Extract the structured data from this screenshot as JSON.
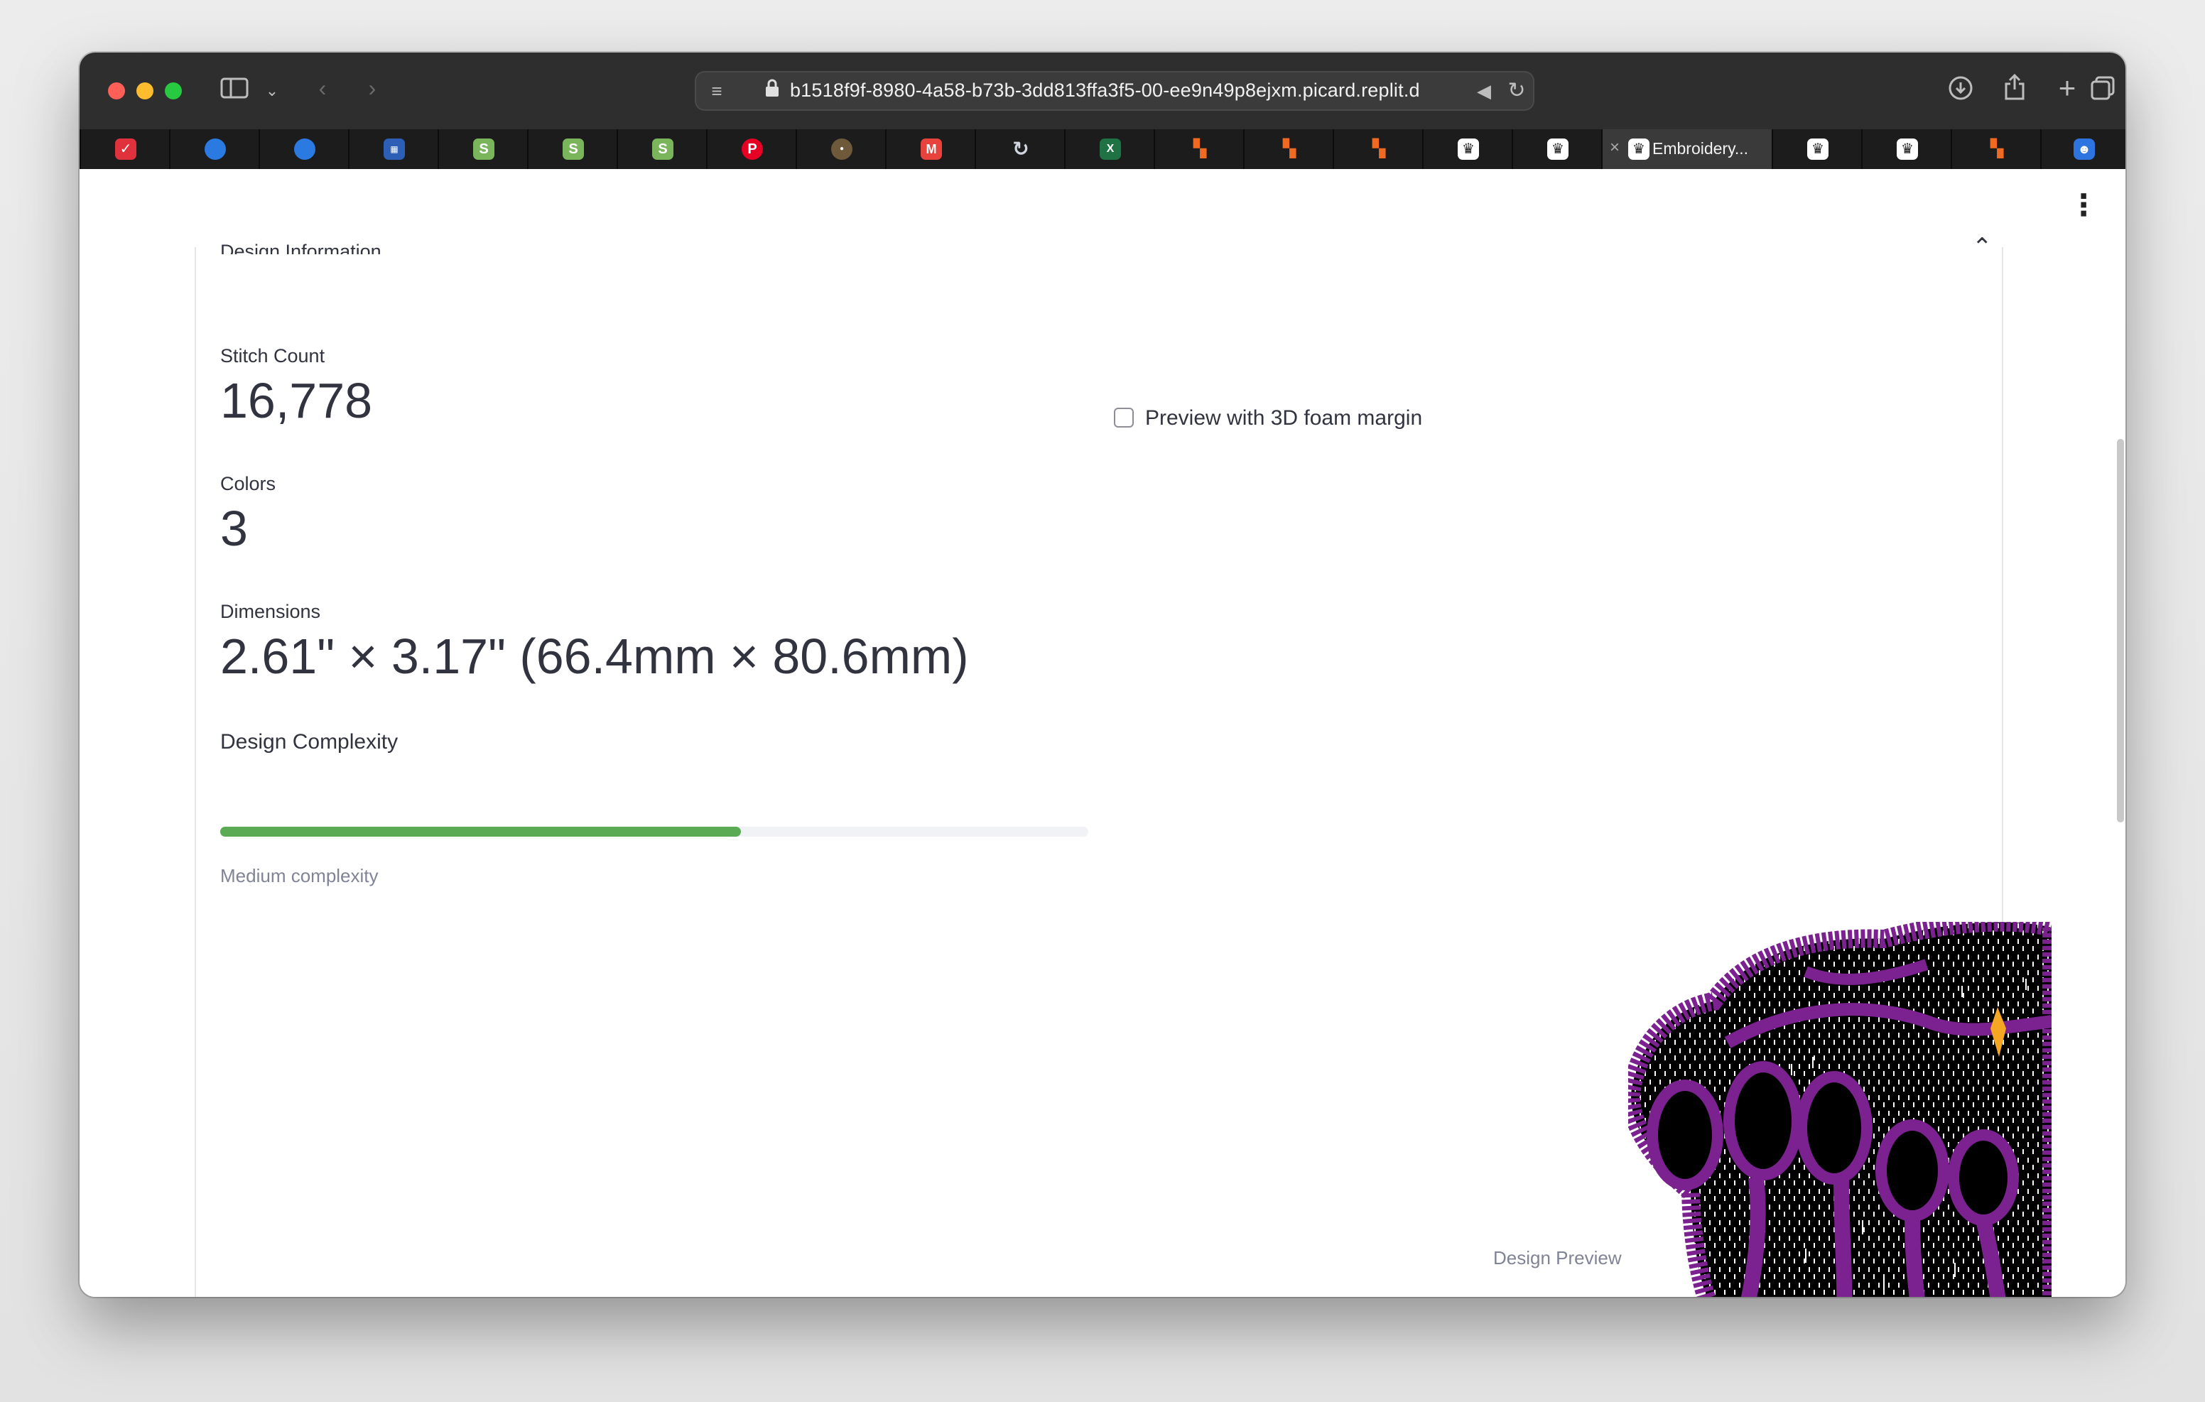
{
  "browser": {
    "url": "b1518f9f-8980-4a58-b73b-3dd813ffa3f5-00-ee9n49p8ejxm.picard.replit.d",
    "active_tab_title": "Embroidery...",
    "tabs": [
      {
        "icon": "checklist-app-icon",
        "color": "#e0323c"
      },
      {
        "icon": "blue-circle-icon",
        "color": "#2a7ae2"
      },
      {
        "icon": "blue-circle-icon",
        "color": "#2a7ae2"
      },
      {
        "icon": "card-app-icon",
        "color": "#2d5fb6"
      },
      {
        "icon": "shopify-icon",
        "color": "#7ab55c"
      },
      {
        "icon": "shopify-icon",
        "color": "#7ab55c"
      },
      {
        "icon": "shopify-icon",
        "color": "#7ab55c"
      },
      {
        "icon": "pinterest-icon",
        "color": "#e60023"
      },
      {
        "icon": "round-logo-icon",
        "color": "#6e5a3a"
      },
      {
        "icon": "mail-icon",
        "color": "#e8423c"
      },
      {
        "icon": "sync-icon",
        "color": "#9aa4b2"
      },
      {
        "icon": "excel-icon",
        "color": "#1f7244"
      },
      {
        "icon": "orange-blocks-icon",
        "color": "#f06a22"
      },
      {
        "icon": "orange-blocks-icon",
        "color": "#f06a22"
      },
      {
        "icon": "orange-blocks-icon",
        "color": "#f06a22"
      },
      {
        "icon": "crown-icon",
        "color": "#ffffff"
      },
      {
        "icon": "crown-icon",
        "color": "#ffffff"
      },
      {
        "icon": "crown-icon",
        "color": "#ffffff",
        "active": true
      },
      {
        "icon": "crown-icon",
        "color": "#ffffff"
      },
      {
        "icon": "crown-icon",
        "color": "#ffffff"
      },
      {
        "icon": "orange-blocks-icon",
        "color": "#f06a22"
      },
      {
        "icon": "chat-app-icon",
        "color": "#2d74e0"
      }
    ]
  },
  "page": {
    "section_title": "Design Information",
    "stitch_count": {
      "label": "Stitch Count",
      "value": "16,778"
    },
    "colors": {
      "label": "Colors",
      "value": "3"
    },
    "dimensions": {
      "label": "Dimensions",
      "value": "2.61\" × 3.17\" (66.4mm × 80.6mm)"
    },
    "complexity": {
      "label": "Design Complexity",
      "caption": "Medium complexity",
      "progress_fraction": 0.6
    },
    "foam_checkbox": {
      "label": "Preview with 3D foam margin",
      "checked": false
    },
    "preview_caption": "Design Preview",
    "accent_color": "#5bab55",
    "design_colors": [
      "#7b2290",
      "#000000",
      "#ffffff",
      "#f5a623"
    ]
  }
}
